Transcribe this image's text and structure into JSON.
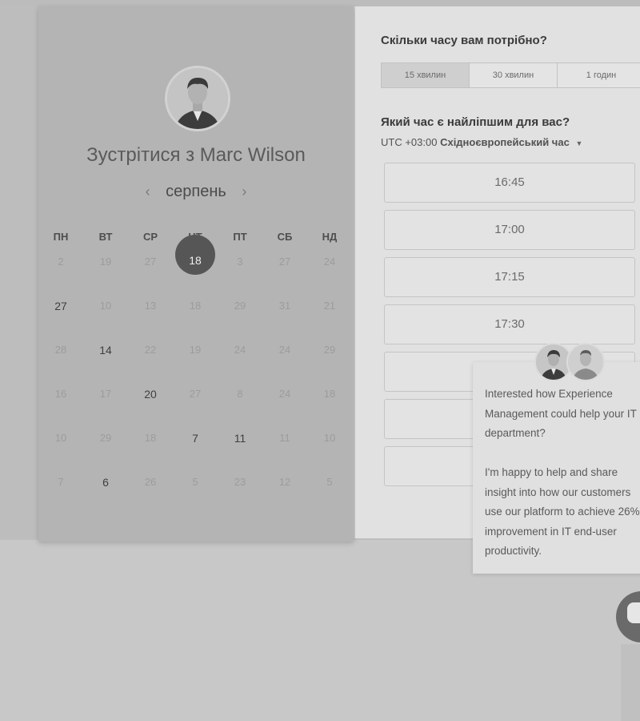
{
  "calendar": {
    "host_title": "Зустрітися з Marc Wilson",
    "month": "серпень",
    "prev_icon": "chevron-left-icon",
    "next_icon": "chevron-right-icon",
    "weekdays": [
      "ПН",
      "ВТ",
      "СР",
      "ЧТ",
      "ПТ",
      "СБ",
      "НД"
    ],
    "selected_day": "18",
    "rows": [
      [
        "2",
        "19",
        "27",
        "18",
        "3",
        "27",
        "24"
      ],
      [
        "27",
        "10",
        "13",
        "18",
        "29",
        "31",
        "21"
      ],
      [
        "28",
        "14",
        "22",
        "19",
        "24",
        "24",
        "29"
      ],
      [
        "16",
        "17",
        "20",
        "27",
        "8",
        "24",
        "18"
      ],
      [
        "10",
        "29",
        "18",
        "7",
        "11",
        "11",
        "10"
      ],
      [
        "7",
        "6",
        "26",
        "5",
        "23",
        "12",
        "5"
      ]
    ]
  },
  "booking": {
    "duration_question": "Скільки часу вам потрібно?",
    "durations": [
      "15 хвилин",
      "30 хвилин",
      "1 годин"
    ],
    "time_question": "Який час є найліпшим для вас?",
    "timezone_offset": "UTC +03:00",
    "timezone_name": "Східноєвропейський час",
    "timezone_caret_icon": "caret-down-icon",
    "slots": [
      "16:45",
      "17:00",
      "17:15",
      "17:30",
      "",
      "",
      ""
    ]
  },
  "chat": {
    "message_lines": [
      "Interested how Experience",
      "Management could help your IT",
      "department?",
      "",
      "I'm happy to help and share",
      "insight into how our customers",
      "use our platform to achieve 26%",
      "improvement in IT end-user",
      "productivity."
    ],
    "launcher_icon": "chat-bubble-icon"
  }
}
